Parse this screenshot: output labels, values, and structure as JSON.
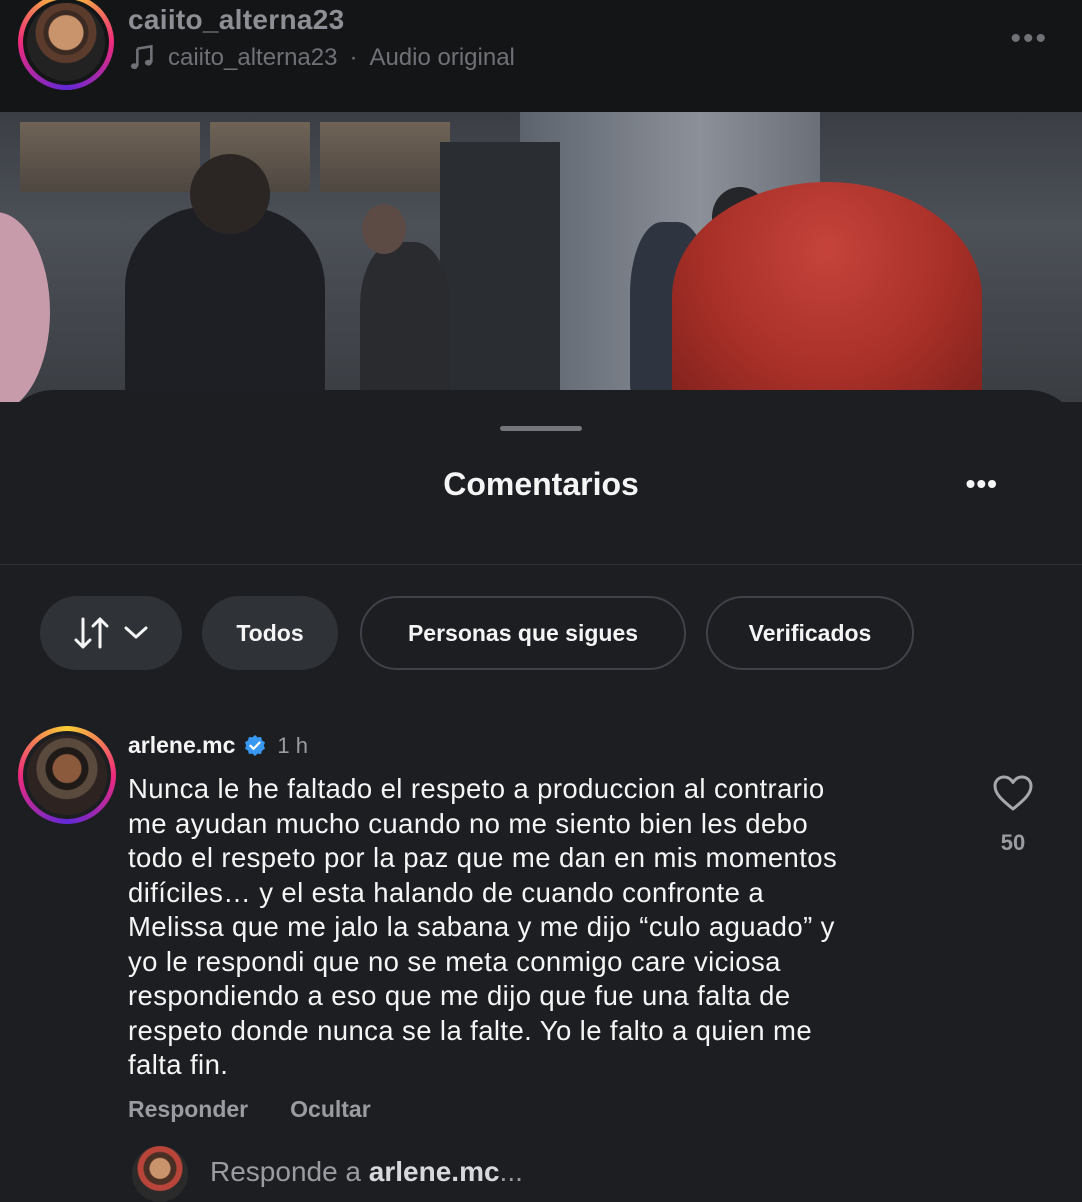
{
  "header": {
    "username": "caiito_alterna23",
    "audio_owner": "caiito_alterna23",
    "audio_separator": "·",
    "audio_label": "Audio original",
    "more_icon": "more-horizontal-icon"
  },
  "comments_sheet": {
    "title": "Comentarios",
    "filters": {
      "sort_icon": "sort-arrows-icon",
      "chevron_icon": "chevron-down-icon",
      "chips": [
        "Todos",
        "Personas que sigues",
        "Verificados"
      ]
    },
    "comment": {
      "username": "arlene.mc",
      "verified": true,
      "time": "1 h",
      "lines": [
        "Nunca le he faltado el respeto a produccion al contrario",
        "me ayudan mucho cuando no me siento bien les debo",
        "todo el respeto por la paz que me dan en mis momentos",
        "difíciles… y el esta halando de cuando confronte a",
        "Melissa que me jalo la sabana y me dijo “culo aguado” y",
        "yo le respondi que no se meta conmigo care viciosa",
        "respondiendo a eso que me dijo que fue una falta de",
        "respeto donde nunca se la falte. Yo le falto a quien me",
        "falta fin."
      ],
      "likes": "50",
      "actions": {
        "reply": "Responder",
        "hide": "Ocultar"
      }
    },
    "reply_box": {
      "prefix": "Responde a",
      "target": "arlene.mc",
      "suffix": "..."
    }
  },
  "colors": {
    "background": "#1c1e22",
    "header_background": "#141517",
    "verified_blue": "#3897f0",
    "chip_fill": "#2f3237"
  }
}
